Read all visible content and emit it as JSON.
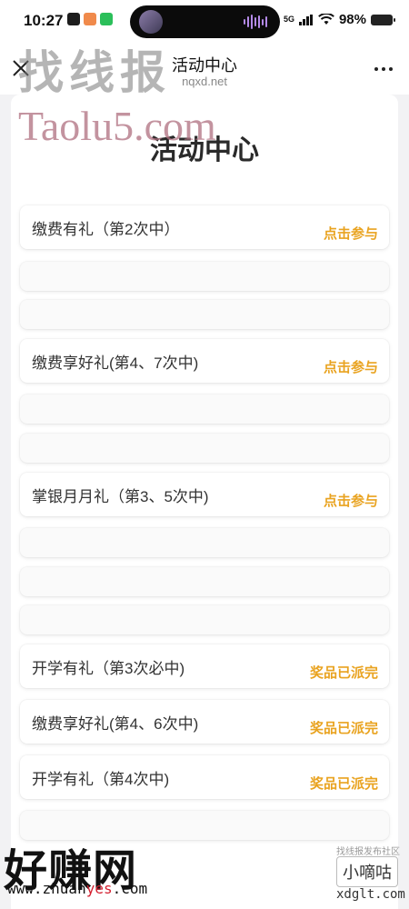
{
  "status_bar": {
    "time": "10:27",
    "network": "5G",
    "battery": "98%"
  },
  "nav": {
    "title": "活动中心",
    "domain": "nqxd.net"
  },
  "page": {
    "heading": "活动中心"
  },
  "activities": [
    {
      "label": "缴费有礼（第2次中）",
      "action": "点击参与"
    },
    {
      "label": "缴费享好礼(第4、7次中)",
      "action": "点击参与"
    },
    {
      "label": "掌银月月礼（第3、5次中)",
      "action": "点击参与"
    },
    {
      "label": "开学有礼（第3次必中)",
      "action": "奖品已派完"
    },
    {
      "label": "缴费享好礼(第4、6次中)",
      "action": "奖品已派完"
    },
    {
      "label": "开学有礼（第4次中)",
      "action": "奖品已派完"
    }
  ],
  "watermarks": {
    "top": "找线报",
    "taolu": "Taolu5.com",
    "bottom_cn": "好赚网",
    "bottom_url_a": "www.zhuan",
    "bottom_url_b": "yes",
    "bottom_url_c": ".com",
    "xiaodigu": "小嘀咕",
    "xiaodigu_small": "找线报发布社区",
    "xdglt": "xdglt.com"
  },
  "colors": {
    "accent": "#e9a320",
    "card_bg": "#ffffff",
    "page_bg": "#f2f2f4"
  }
}
